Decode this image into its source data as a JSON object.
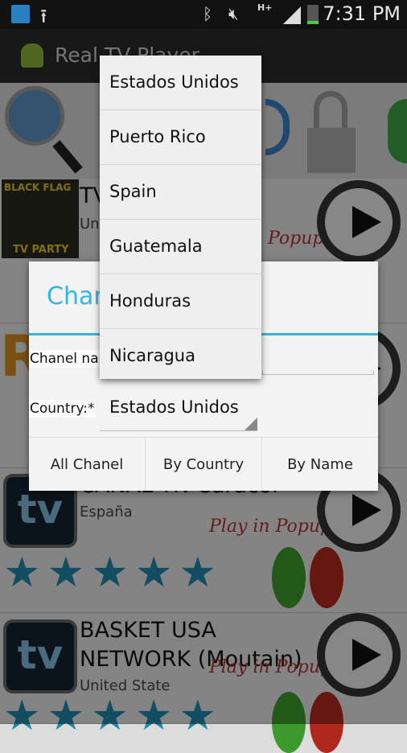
{
  "status_bar": {
    "time": "7:31 PM",
    "icons": [
      "wifi-icon",
      "upload-icon",
      "bluetooth-icon",
      "mute-icon",
      "hplus-data-icon",
      "signal-icon",
      "battery-charging-icon"
    ],
    "network_label": "H+"
  },
  "action_bar": {
    "title": "Real TV Player",
    "icon": "android-icon"
  },
  "toolbar": {
    "icons": [
      "search-icon",
      "refresh-icon",
      "lock-users-icon",
      "round-button-icon"
    ]
  },
  "list": [
    {
      "title": "TV",
      "subtitle": "Un",
      "popup": "Popup",
      "thumb_text": "BLACK FLAG",
      "thumb_sub": "TV PARTY"
    },
    {
      "thumb_text": "R"
    },
    {
      "title": "CANAL TN Caracol",
      "subtitle": "España",
      "popup": "Play in Popup",
      "thumb_text": "tv",
      "stars": "★★★★★"
    },
    {
      "title": "BASKET USA NETWORK (Moutain)",
      "subtitle": "United State",
      "popup": "Play in Popup",
      "thumb_text": "tv",
      "stars": "★★★★★"
    }
  ],
  "dialog": {
    "title": "Chan",
    "name_label": "Chanel na",
    "country_label": "Country:*",
    "country_value": "Estados Unidos",
    "buttons": [
      "All Chanel",
      "By Country",
      "By Name"
    ],
    "accent": "#33b5e5"
  },
  "dropdown": {
    "options": [
      "Estados Unidos",
      "Puerto Rico",
      "Spain",
      "Guatemala",
      "Honduras",
      "Nicaragua"
    ]
  }
}
